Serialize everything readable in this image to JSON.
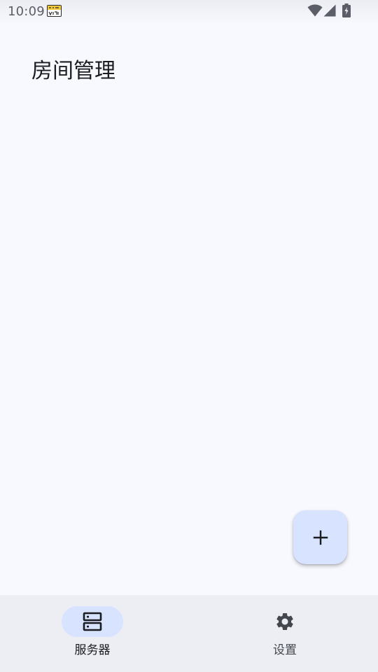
{
  "status_bar": {
    "time": "10:09"
  },
  "page": {
    "title": "房间管理"
  },
  "fab": {
    "icon": "plus-icon"
  },
  "nav": {
    "items": [
      {
        "label": "服务器",
        "icon": "server-icon",
        "selected": true
      },
      {
        "label": "设置",
        "icon": "gear-icon",
        "selected": false
      }
    ]
  },
  "colors": {
    "background": "#f8f9ff",
    "nav_background": "#eceef4",
    "accent_container": "#d7e3ff",
    "on_surface": "#1b1c20"
  }
}
